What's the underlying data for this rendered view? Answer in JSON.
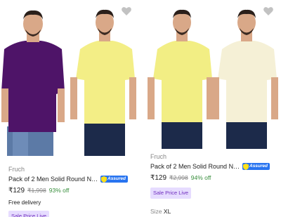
{
  "products": [
    {
      "brand": "Fruch",
      "title": "Pack of 2 Men Solid Round Neck ...",
      "assured_label": "Assured",
      "price": "₹129",
      "mrp": "₹1,998",
      "discount": "93% off",
      "delivery": "Free delivery",
      "badge": "Sale Price Live",
      "colors": {
        "shirt1": "#4e1468",
        "shirt2": "#f3ee86"
      }
    },
    {
      "brand": "Fruch",
      "title": "Pack of 2 Men Solid Round Neck ...",
      "assured_label": "Assured",
      "price": "₹129",
      "mrp": "₹2,998",
      "discount": "94% off",
      "badge": "Sale Price Live",
      "size_label": "Size",
      "size_value": "XL",
      "colors": {
        "shirt1": "#f2ee84",
        "shirt2": "#f5f0d6"
      }
    }
  ],
  "icons": {
    "wishlist": "heart-icon",
    "assured": "shield-icon"
  },
  "accent": {
    "assured": "#2874f0",
    "discount": "#388e3c",
    "badge_bg": "#e6dcff",
    "badge_text": "#6f2dbd"
  }
}
